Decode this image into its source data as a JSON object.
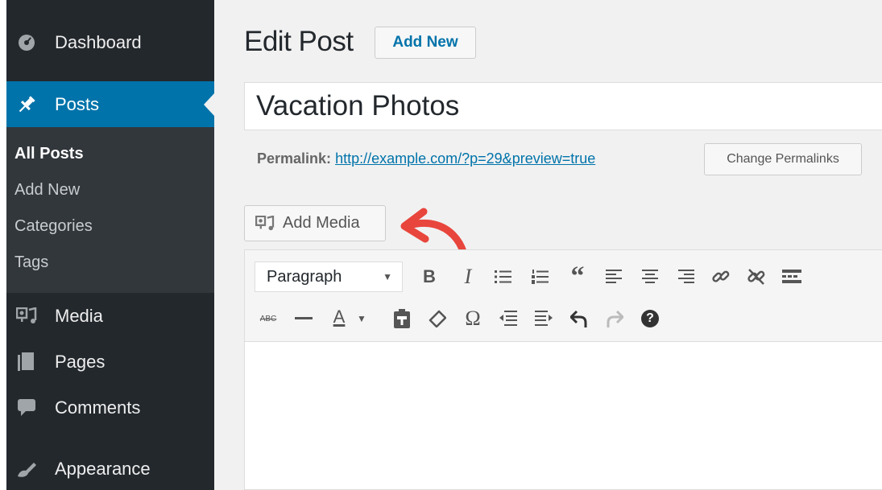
{
  "sidebar": {
    "items": [
      {
        "label": "Dashboard",
        "icon": "dashboard-icon"
      },
      {
        "label": "Posts",
        "icon": "pin-icon",
        "active": true
      },
      {
        "label": "Media",
        "icon": "media-icon"
      },
      {
        "label": "Pages",
        "icon": "pages-icon"
      },
      {
        "label": "Comments",
        "icon": "comments-icon"
      },
      {
        "label": "Appearance",
        "icon": "appearance-icon"
      }
    ],
    "submenu": [
      {
        "label": "All Posts",
        "current": true
      },
      {
        "label": "Add New"
      },
      {
        "label": "Categories"
      },
      {
        "label": "Tags"
      }
    ]
  },
  "header": {
    "title": "Edit Post",
    "add_new_label": "Add New"
  },
  "post": {
    "title_value": "Vacation Photos",
    "permalink_label": "Permalink:",
    "permalink_url": "http://example.com/?p=29&preview=true",
    "change_permalinks_label": "Change Permalinks"
  },
  "editor": {
    "add_media_label": "Add Media",
    "format_select_value": "Paragraph",
    "toolbar_row1": [
      "bold-icon",
      "italic-icon",
      "bulleted-list-icon",
      "numbered-list-icon",
      "blockquote-icon",
      "align-left-icon",
      "align-center-icon",
      "align-right-icon",
      "insert-link-icon",
      "remove-link-icon",
      "read-more-icon"
    ],
    "toolbar_row2": [
      "strikethrough-icon",
      "horizontal-line-icon",
      "text-color-icon",
      "paste-as-text-icon",
      "clear-formatting-icon",
      "special-character-icon",
      "decrease-indent-icon",
      "increase-indent-icon",
      "undo-icon",
      "redo-icon",
      "help-icon"
    ],
    "bold_glyph": "B",
    "italic_glyph": "I",
    "quote_glyph": "“",
    "strike_glyph": "ABC",
    "text_color_glyph": "A",
    "omega_glyph": "Ω",
    "help_glyph": "?"
  },
  "colors": {
    "sidebar_bg": "#23282d",
    "active_bg": "#0073aa",
    "link": "#0073aa",
    "annotation_arrow": "#e8453c"
  }
}
